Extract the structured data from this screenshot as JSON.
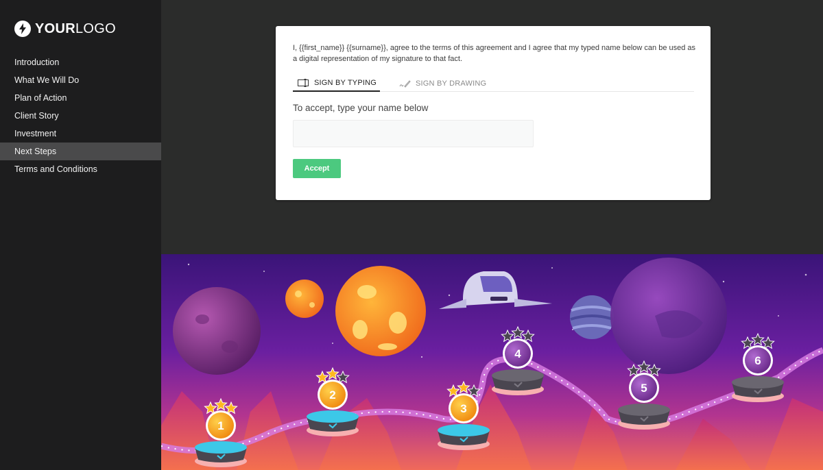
{
  "brand": {
    "logo_bold": "YOUR",
    "logo_light": "LOGO",
    "logo_icon": "lightning-bolt-icon"
  },
  "sidebar": {
    "items": [
      {
        "label": "Introduction",
        "active": false
      },
      {
        "label": "What We Will Do",
        "active": false
      },
      {
        "label": "Plan of Action",
        "active": false
      },
      {
        "label": "Client Story",
        "active": false
      },
      {
        "label": "Investment",
        "active": false
      },
      {
        "label": "Next Steps",
        "active": true
      },
      {
        "label": "Terms and Conditions",
        "active": false
      }
    ]
  },
  "signature": {
    "agreement_text": "I, {{first_name}} {{surname}}, agree to the terms of this agreement and I agree that my typed name below can be used as a digital representation of my signature to that fact.",
    "tabs": [
      {
        "label": "SIGN BY TYPING",
        "icon": "text-cursor-icon",
        "active": true
      },
      {
        "label": "SIGN BY DRAWING",
        "icon": "pen-signature-icon",
        "active": false
      }
    ],
    "prompt": "To accept, type your name below",
    "name_value": "",
    "name_placeholder": "",
    "accept_label": "Accept",
    "accept_color": "#4cc97f"
  },
  "illustration": {
    "description": "Space-themed game level map",
    "levels": [
      {
        "number": "1",
        "stars": 3,
        "completed": true
      },
      {
        "number": "2",
        "stars": 2,
        "completed": true
      },
      {
        "number": "3",
        "stars": 2,
        "completed": true
      },
      {
        "number": "4",
        "stars": 0,
        "completed": false
      },
      {
        "number": "5",
        "stars": 0,
        "completed": false
      },
      {
        "number": "6",
        "stars": 0,
        "completed": false
      }
    ]
  },
  "colors": {
    "sidebar_bg": "#1d1d1e",
    "sidebar_active": "#4a4a4b",
    "page_bg": "#2b2c2b"
  }
}
